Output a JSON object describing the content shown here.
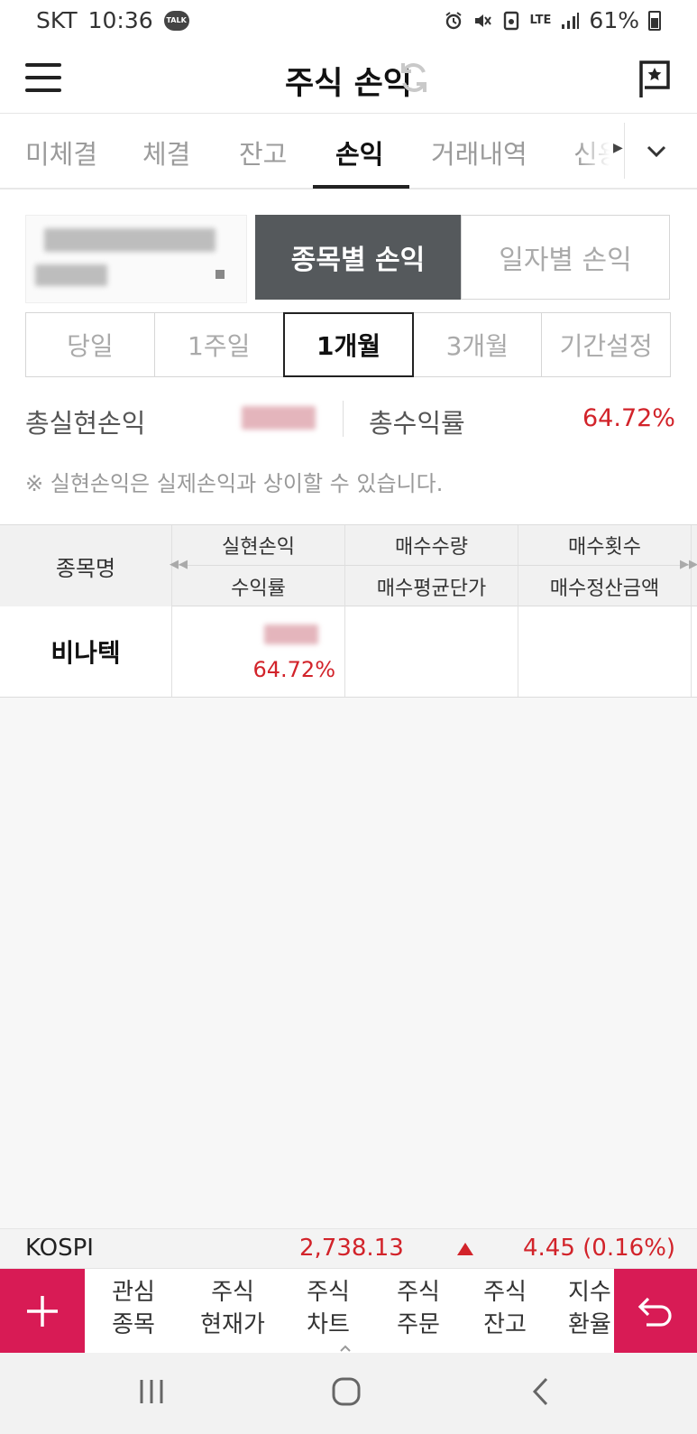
{
  "status_bar": {
    "carrier": "SKT",
    "time": "10:36",
    "talk_badge": "TALK",
    "network": "LTE",
    "battery": "61%"
  },
  "header": {
    "title": "주식 손익"
  },
  "tabs": [
    {
      "label": "미체결"
    },
    {
      "label": "체결"
    },
    {
      "label": "잔고"
    },
    {
      "label": "손익",
      "active": true
    },
    {
      "label": "거래내역"
    },
    {
      "label": "신용"
    }
  ],
  "toggle": {
    "left": "종목별 손익",
    "right": "일자별 손익",
    "selected": "left"
  },
  "periods": [
    "당일",
    "1주일",
    "1개월",
    "3개월",
    "기간설정"
  ],
  "selected_period": "1개월",
  "summary": {
    "realized_label": "총실현손익",
    "return_label": "총수익률",
    "return_value": "64.72%"
  },
  "notice": "※ 실현손익은 실제손익과 상이할 수 있습니다.",
  "table": {
    "header_stock": "종목명",
    "col1_top": "실현손익",
    "col1_bottom": "수익률",
    "col2_top": "매수수량",
    "col2_bottom": "매수평균단가",
    "col3_top": "매수횟수",
    "col3_bottom": "매수정산금액",
    "rows": [
      {
        "name": "비나텍",
        "return": "64.72%"
      }
    ]
  },
  "kospi": {
    "label": "KOSPI",
    "value": "2,738.13",
    "change": "4.45 (0.16%)",
    "direction": "up"
  },
  "quick_menu": [
    {
      "line1": "관심",
      "line2": "종목"
    },
    {
      "line1": "주식",
      "line2": "현재가"
    },
    {
      "line1": "주식",
      "line2": "차트"
    },
    {
      "line1": "주식",
      "line2": "주문"
    },
    {
      "line1": "주식",
      "line2": "잔고"
    },
    {
      "line1": "지수",
      "line2": "환율"
    }
  ],
  "colors": {
    "accent": "#d81b55",
    "up_red": "#d2232a",
    "selected_dark": "#55595c"
  }
}
